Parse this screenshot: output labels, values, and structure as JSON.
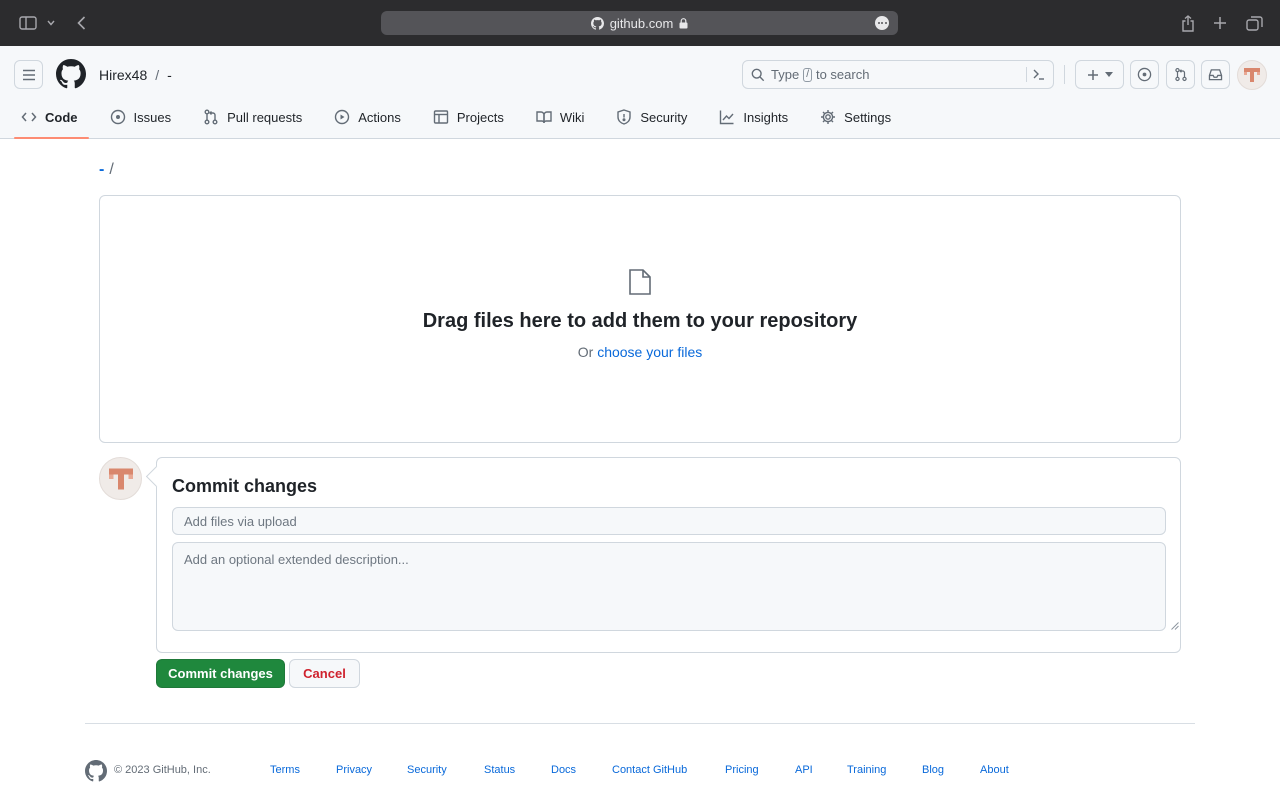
{
  "browser": {
    "url": "github.com"
  },
  "header": {
    "owner": "Hirex48",
    "separator": "/",
    "repo": "-",
    "search_placeholder_prefix": "Type",
    "search_key": "/",
    "search_placeholder_suffix": "to search"
  },
  "nav": {
    "tabs": [
      {
        "label": "Code",
        "icon": "code-icon",
        "active": true
      },
      {
        "label": "Issues",
        "icon": "issue-opened-icon"
      },
      {
        "label": "Pull requests",
        "icon": "git-pull-request-icon"
      },
      {
        "label": "Actions",
        "icon": "play-icon"
      },
      {
        "label": "Projects",
        "icon": "table-icon"
      },
      {
        "label": "Wiki",
        "icon": "book-icon"
      },
      {
        "label": "Security",
        "icon": "shield-icon"
      },
      {
        "label": "Insights",
        "icon": "graph-icon"
      },
      {
        "label": "Settings",
        "icon": "gear-icon"
      }
    ]
  },
  "path": {
    "repo": "-",
    "slash": "/"
  },
  "dropzone": {
    "title": "Drag files here to add them to your repository",
    "or_text": "Or",
    "choose_link": "choose your files"
  },
  "commit": {
    "title": "Commit changes",
    "summary_placeholder": "Add files via upload",
    "description_placeholder": "Add an optional extended description...",
    "commit_button": "Commit changes",
    "cancel_button": "Cancel"
  },
  "footer": {
    "copyright": "© 2023 GitHub, Inc.",
    "links": [
      "Terms",
      "Privacy",
      "Security",
      "Status",
      "Docs",
      "Contact GitHub",
      "Pricing",
      "API",
      "Training",
      "Blog",
      "About"
    ]
  },
  "colors": {
    "accent_link": "#0969da",
    "active_tab_underline": "#fd8c73",
    "commit_button": "#1f883d",
    "cancel_text": "#cf222e"
  }
}
